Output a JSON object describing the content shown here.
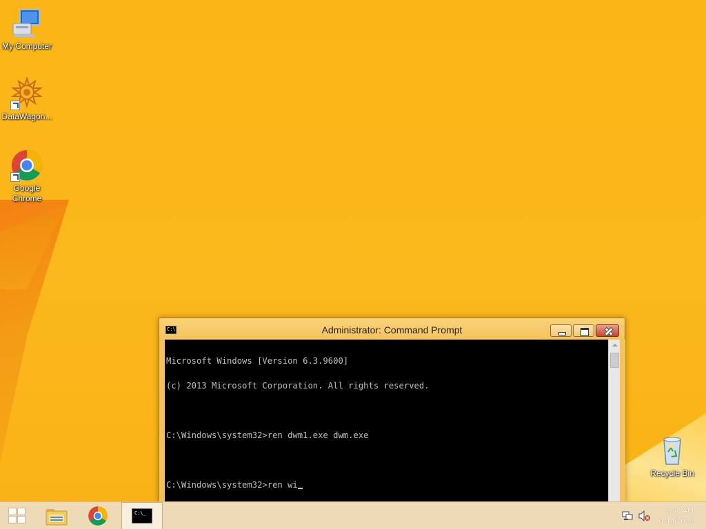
{
  "desktop": {
    "icons": [
      {
        "label": "My Computer",
        "icon": "my-computer-icon"
      },
      {
        "label": "DataWagon...",
        "icon": "datawagon-icon"
      },
      {
        "label": "Google Chrome",
        "icon": "chrome-icon"
      },
      {
        "label": "Recycle Bin",
        "icon": "recycle-bin-icon"
      }
    ]
  },
  "cmd_window": {
    "title": "Administrator: Command Prompt",
    "lines": [
      "Microsoft Windows [Version 6.3.9600]",
      "(c) 2013 Microsoft Corporation. All rights reserved.",
      "",
      "C:\\Windows\\system32>ren dwm1.exe dwm.exe",
      "",
      "C:\\Windows\\system32>ren wi"
    ]
  },
  "taskbar": {
    "items": [
      {
        "name": "start",
        "icon": "windows-logo-icon"
      },
      {
        "name": "file-explorer",
        "icon": "folder-icon"
      },
      {
        "name": "google-chrome",
        "icon": "chrome-icon"
      },
      {
        "name": "command-prompt",
        "icon": "cmd-icon",
        "active": true
      }
    ],
    "tray": {
      "network_icon": "network-icon",
      "volume_icon": "volume-muted-icon",
      "time": "5:56 AM",
      "date": "1/14/2022"
    }
  },
  "colors": {
    "wallpaper": "#fbb516",
    "console_bg": "#000000",
    "console_text": "#c0c0c0",
    "close_button": "#c8432d"
  }
}
